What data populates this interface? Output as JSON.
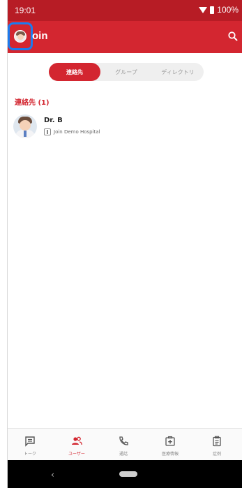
{
  "status_bar": {
    "time": "19:01",
    "battery": "100%"
  },
  "app_bar": {
    "title": "oin"
  },
  "tabs": [
    {
      "label": "連絡先",
      "active": true
    },
    {
      "label": "グループ",
      "active": false
    },
    {
      "label": "ディレクトリ",
      "active": false
    }
  ],
  "section": {
    "title": "連絡先 (1)"
  },
  "contacts": [
    {
      "name": "Dr. B",
      "organization": "Join Demo Hospital"
    }
  ],
  "bottom_nav": [
    {
      "label": "トーク",
      "icon": "chat-icon",
      "active": false
    },
    {
      "label": "ユーザー",
      "icon": "users-icon",
      "active": true
    },
    {
      "label": "通話",
      "icon": "phone-icon",
      "active": false
    },
    {
      "label": "医療情報",
      "icon": "medical-icon",
      "active": false
    },
    {
      "label": "症例",
      "icon": "clipboard-icon",
      "active": false
    }
  ],
  "system_nav": {
    "back": "‹"
  },
  "colors": {
    "primary": "#d32630",
    "status_bar": "#b71c25",
    "highlight": "#1a7cf0"
  }
}
